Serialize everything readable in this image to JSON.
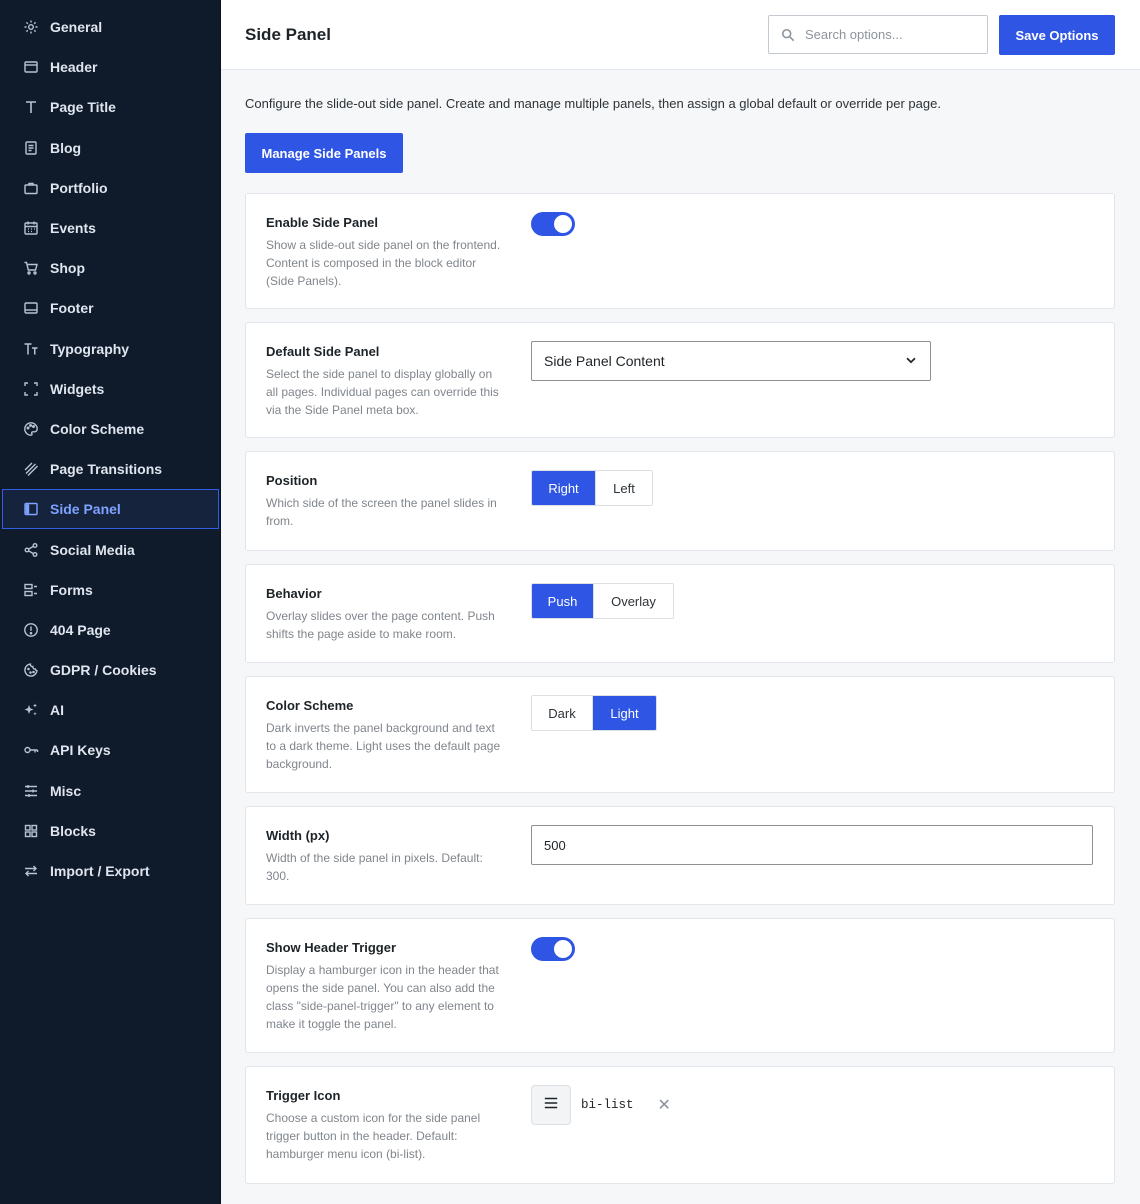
{
  "sidebar": {
    "items": [
      {
        "label": "General",
        "icon": "gear-icon"
      },
      {
        "label": "Header",
        "icon": "window-icon"
      },
      {
        "label": "Page Title",
        "icon": "type-icon"
      },
      {
        "label": "Blog",
        "icon": "document-icon"
      },
      {
        "label": "Portfolio",
        "icon": "briefcase-icon"
      },
      {
        "label": "Events",
        "icon": "calendar-icon"
      },
      {
        "label": "Shop",
        "icon": "cart-icon"
      },
      {
        "label": "Footer",
        "icon": "footer-icon"
      },
      {
        "label": "Typography",
        "icon": "typography-icon"
      },
      {
        "label": "Widgets",
        "icon": "widgets-icon"
      },
      {
        "label": "Color Scheme",
        "icon": "palette-icon"
      },
      {
        "label": "Page Transitions",
        "icon": "transition-icon"
      },
      {
        "label": "Side Panel",
        "icon": "side-panel-icon",
        "active": true
      },
      {
        "label": "Social Media",
        "icon": "share-icon"
      },
      {
        "label": "Forms",
        "icon": "forms-icon"
      },
      {
        "label": "404 Page",
        "icon": "alert-icon"
      },
      {
        "label": "GDPR / Cookies",
        "icon": "cookie-icon"
      },
      {
        "label": "AI",
        "icon": "sparkles-icon"
      },
      {
        "label": "API Keys",
        "icon": "key-icon"
      },
      {
        "label": "Misc",
        "icon": "sliders-icon"
      },
      {
        "label": "Blocks",
        "icon": "grid-icon"
      },
      {
        "label": "Import / Export",
        "icon": "arrows-icon"
      }
    ]
  },
  "header": {
    "title": "Side Panel",
    "search_placeholder": "Search options...",
    "save_label": "Save Options"
  },
  "main": {
    "intro": "Configure the slide-out side panel. Create and manage multiple panels, then assign a global default or override per page.",
    "manage_label": "Manage Side Panels",
    "settings": {
      "enable": {
        "label": "Enable Side Panel",
        "desc": "Show a slide-out side panel on the frontend. Content is composed in the block editor (Side Panels).",
        "value": true
      },
      "default_panel": {
        "label": "Default Side Panel",
        "desc": "Select the side panel to display globally on all pages. Individual pages can override this via the Side Panel meta box.",
        "value": "Side Panel Content"
      },
      "position": {
        "label": "Position",
        "desc": "Which side of the screen the panel slides in from.",
        "options": [
          "Right",
          "Left"
        ],
        "selected": "Right"
      },
      "behavior": {
        "label": "Behavior",
        "desc": "Overlay slides over the page content. Push shifts the page aside to make room.",
        "options": [
          "Push",
          "Overlay"
        ],
        "selected": "Push"
      },
      "color_scheme": {
        "label": "Color Scheme",
        "desc": "Dark inverts the panel background and text to a dark theme. Light uses the default page background.",
        "options": [
          "Dark",
          "Light"
        ],
        "selected": "Light"
      },
      "width": {
        "label": "Width (px)",
        "desc": "Width of the side panel in pixels. Default: 300.",
        "value": "500"
      },
      "header_trigger": {
        "label": "Show Header Trigger",
        "desc": "Display a hamburger icon in the header that opens the side panel. You can also add the class \"side-panel-trigger\" to any element to make it toggle the panel.",
        "value": true
      },
      "trigger_icon": {
        "label": "Trigger Icon",
        "desc": "Choose a custom icon for the side panel trigger button in the header. Default: hamburger menu icon (bi-list).",
        "value": "bi-list",
        "icon": "hamburger-icon"
      }
    }
  },
  "colors": {
    "accent": "#2f55e4",
    "sidebar_bg": "#0f1a2b",
    "active_text": "#7ea2ff"
  }
}
